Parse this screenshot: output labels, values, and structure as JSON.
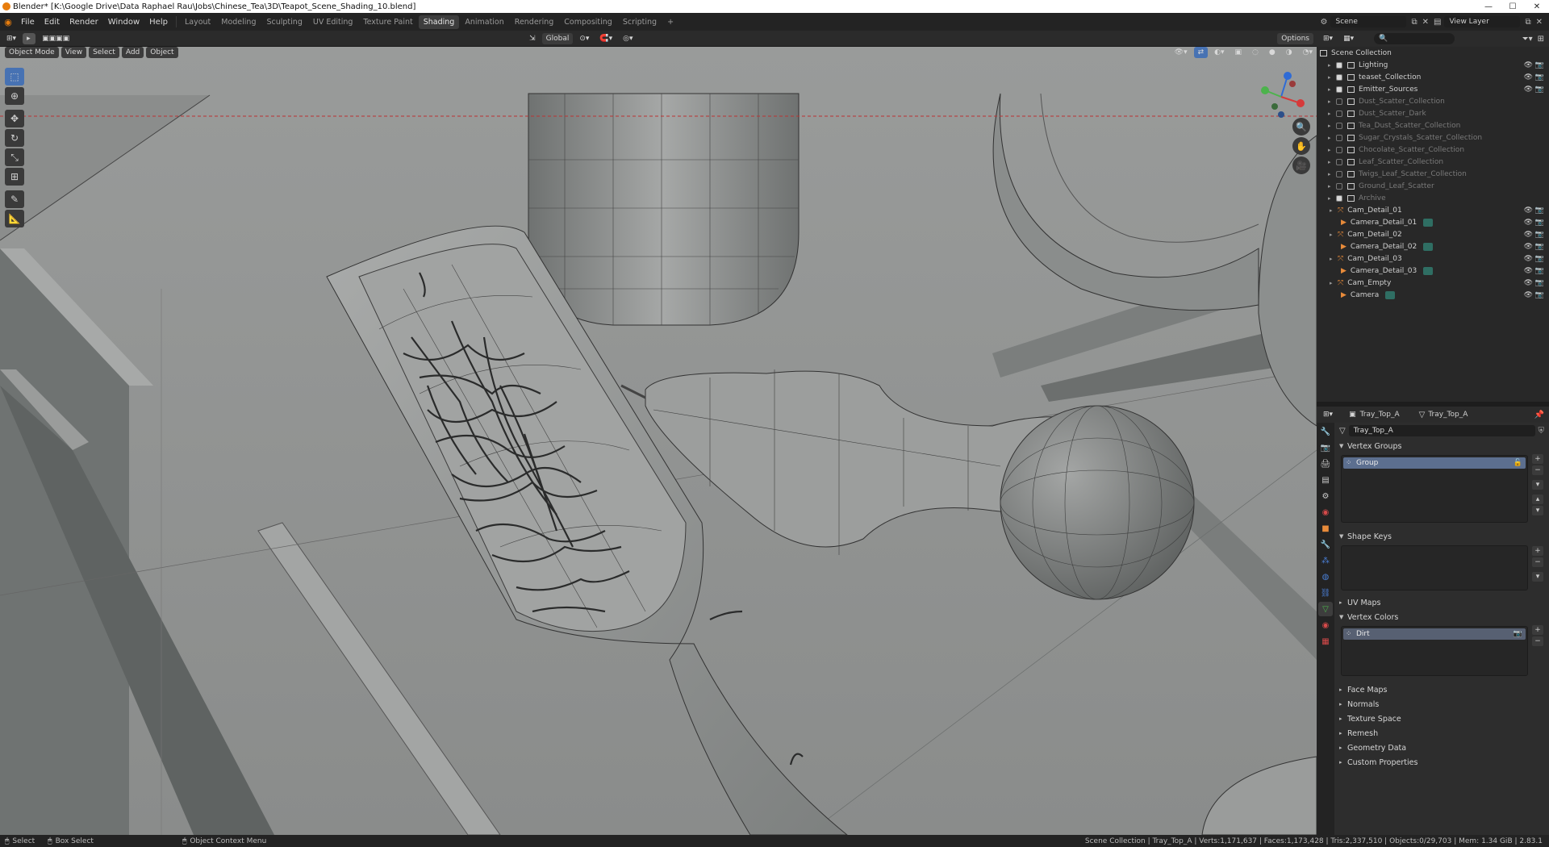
{
  "window": {
    "title": "Blender* [K:\\Google Drive\\Data Raphael Rau\\Jobs\\Chinese_Tea\\3D\\Teapot_Scene_Shading_10.blend]"
  },
  "menu": {
    "items": [
      "File",
      "Edit",
      "Render",
      "Window",
      "Help"
    ],
    "workspaces": [
      "Layout",
      "Modeling",
      "Sculpting",
      "UV Editing",
      "Texture Paint",
      "Shading",
      "Animation",
      "Rendering",
      "Compositing",
      "Scripting"
    ],
    "active_workspace": "Shading",
    "add_tab": "+",
    "scene_label": "Scene",
    "view_layer_label": "View Layer"
  },
  "viewport_header": {
    "mode": "Object Mode",
    "menus": [
      "View",
      "Select",
      "Add",
      "Object"
    ],
    "transform_orientation": "Global",
    "options": "Options"
  },
  "toolbar": {
    "tools": [
      "select-box",
      "cursor",
      "move",
      "rotate",
      "scale",
      "transform",
      "annotate",
      "measure"
    ]
  },
  "outliner": {
    "root": "Scene Collection",
    "rows": [
      {
        "label": "Lighting",
        "checked": true,
        "dim": false,
        "indent": 1,
        "kind": "collection"
      },
      {
        "label": "teaset_Collection",
        "checked": true,
        "dim": false,
        "indent": 1,
        "kind": "collection"
      },
      {
        "label": "Emitter_Sources",
        "checked": true,
        "dim": false,
        "indent": 1,
        "kind": "collection"
      },
      {
        "label": "Dust_Scatter_Collection",
        "checked": false,
        "dim": true,
        "indent": 1,
        "kind": "collection"
      },
      {
        "label": "Dust_Scatter_Dark",
        "checked": false,
        "dim": true,
        "indent": 1,
        "kind": "collection"
      },
      {
        "label": "Tea_Dust_Scatter_Collection",
        "checked": false,
        "dim": true,
        "indent": 1,
        "kind": "collection"
      },
      {
        "label": "Sugar_Crystals_Scatter_Collection",
        "checked": false,
        "dim": true,
        "indent": 1,
        "kind": "collection"
      },
      {
        "label": "Chocolate_Scatter_Collection",
        "checked": false,
        "dim": true,
        "indent": 1,
        "kind": "collection"
      },
      {
        "label": "Leaf_Scatter_Collection",
        "checked": false,
        "dim": true,
        "indent": 1,
        "kind": "collection"
      },
      {
        "label": "Twigs_Leaf_Scatter_Collection",
        "checked": false,
        "dim": true,
        "indent": 1,
        "kind": "collection"
      },
      {
        "label": "Ground_Leaf_Scatter",
        "checked": false,
        "dim": true,
        "indent": 1,
        "kind": "collection"
      },
      {
        "label": "Archive",
        "checked": true,
        "dim": true,
        "indent": 1,
        "kind": "collection"
      },
      {
        "label": "Cam_Detail_01",
        "checked": null,
        "dim": false,
        "indent": 0,
        "kind": "empty"
      },
      {
        "label": "Camera_Detail_01",
        "checked": null,
        "dim": false,
        "indent": 1,
        "kind": "camera"
      },
      {
        "label": "Cam_Detail_02",
        "checked": null,
        "dim": false,
        "indent": 0,
        "kind": "empty"
      },
      {
        "label": "Camera_Detail_02",
        "checked": null,
        "dim": false,
        "indent": 1,
        "kind": "camera"
      },
      {
        "label": "Cam_Detail_03",
        "checked": null,
        "dim": false,
        "indent": 0,
        "kind": "empty"
      },
      {
        "label": "Camera_Detail_03",
        "checked": null,
        "dim": false,
        "indent": 1,
        "kind": "camera"
      },
      {
        "label": "Cam_Empty",
        "checked": null,
        "dim": false,
        "indent": 0,
        "kind": "empty"
      },
      {
        "label": "Camera",
        "checked": null,
        "dim": false,
        "indent": 1,
        "kind": "camera"
      }
    ]
  },
  "properties": {
    "object_name": "Tray_Top_A",
    "data_name": "Tray_Top_A",
    "mesh_field": "Tray_Top_A",
    "vertex_groups_title": "Vertex Groups",
    "vertex_group_item": "Group",
    "shape_keys_title": "Shape Keys",
    "uv_maps_title": "UV Maps",
    "vertex_colors_title": "Vertex Colors",
    "vertex_color_item": "Dirt",
    "collapsed_panels": [
      "Face Maps",
      "Normals",
      "Texture Space",
      "Remesh",
      "Geometry Data",
      "Custom Properties"
    ]
  },
  "statusbar": {
    "select": "Select",
    "box_select": "Box Select",
    "context_menu": "Object Context Menu",
    "stats": "Scene Collection | Tray_Top_A | Verts:1,171,637 | Faces:1,173,428 | Tris:2,337,510 | Objects:0/29,703 | Mem: 1.34 GiB | 2.83.1"
  },
  "colors": {
    "accent": "#4772b3",
    "viewport_bg": "#8f9190",
    "orange": "#e88b3a",
    "teal": "#2f6e63"
  }
}
